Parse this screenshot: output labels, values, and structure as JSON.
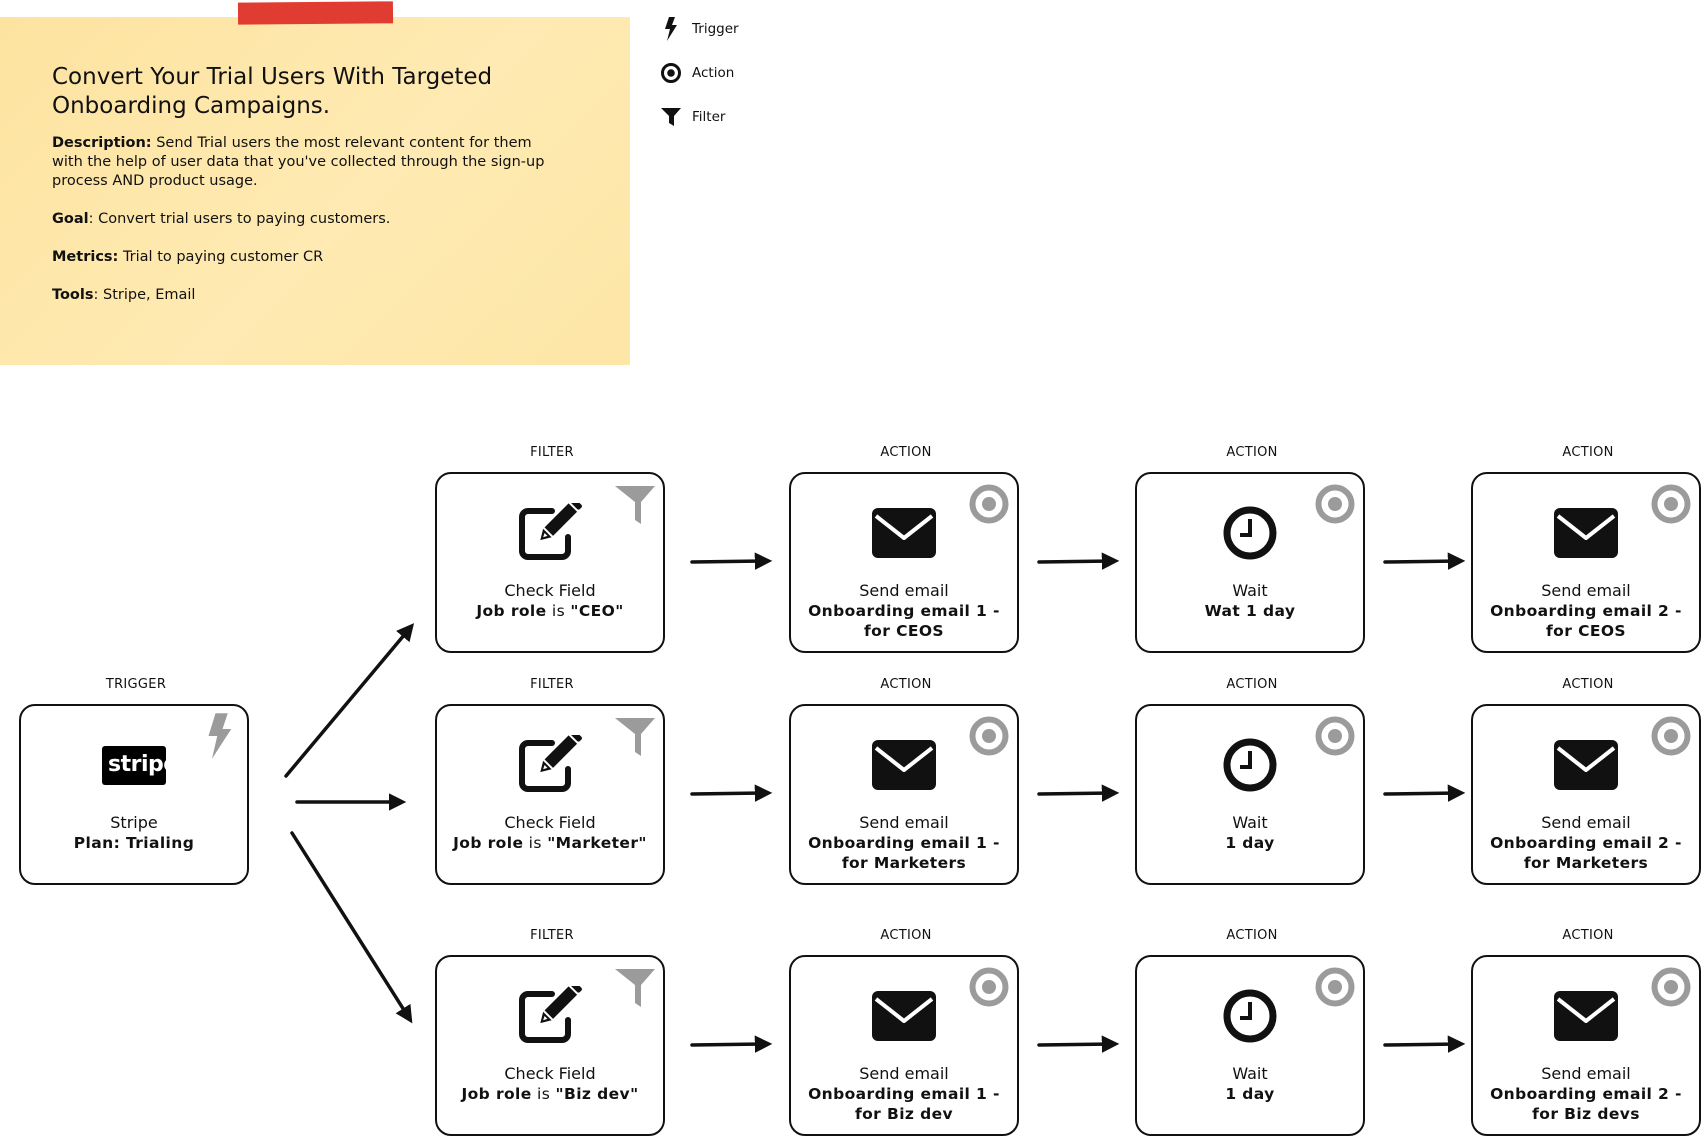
{
  "note": {
    "title": "Convert Your Trial Users With Targeted Onboarding Campaigns.",
    "description_label": "Description:",
    "description_text": " Send Trial users the most relevant content for them with the help of user data that you've collected through the sign-up process AND product usage.",
    "goal_label": "Goal",
    "goal_text": ": Convert trial users to paying customers.",
    "metrics_label": "Metrics:",
    "metrics_text": " Trial to paying customer CR",
    "tools_label": "Tools",
    "tools_text": ": Stripe, Email",
    "tape_color": "#e03c31",
    "paper_color": "#fde7a8"
  },
  "legend": [
    {
      "icon": "lightning-icon",
      "label": "Trigger"
    },
    {
      "icon": "target-icon",
      "label": "Action"
    },
    {
      "icon": "funnel-icon",
      "label": "Filter"
    }
  ],
  "trigger": {
    "stage": "TRIGGER",
    "logo_text": "stripe",
    "title": "Stripe",
    "detail": "Plan: Trialing",
    "corner_icon": "lightning-icon"
  },
  "rows": [
    {
      "filter": {
        "stage": "FILTER",
        "title": "Check Field",
        "detail_pre": "Job role",
        "detail_mid": " is ",
        "detail_post": "\"CEO\"",
        "corner_icon": "funnel-icon",
        "icon": "edit-icon"
      },
      "action1": {
        "stage": "ACTION",
        "title": "Send email",
        "detail": "Onboarding email 1 - for CEOS",
        "corner_icon": "target-icon",
        "icon": "envelope-icon"
      },
      "wait": {
        "stage": "ACTION",
        "title": "Wait",
        "detail": "Wat 1 day",
        "corner_icon": "target-icon",
        "icon": "clock-icon"
      },
      "action2": {
        "stage": "ACTION",
        "title": "Send email",
        "detail": "Onboarding email 2 - for CEOS",
        "corner_icon": "target-icon",
        "icon": "envelope-icon"
      }
    },
    {
      "filter": {
        "stage": "FILTER",
        "title": "Check Field",
        "detail_pre": "Job role",
        "detail_mid": " is ",
        "detail_post": "\"Marketer\"",
        "corner_icon": "funnel-icon",
        "icon": "edit-icon"
      },
      "action1": {
        "stage": "ACTION",
        "title": "Send email",
        "detail": "Onboarding email 1 - for Marketers",
        "corner_icon": "target-icon",
        "icon": "envelope-icon"
      },
      "wait": {
        "stage": "ACTION",
        "title": "Wait",
        "detail": "1 day",
        "corner_icon": "target-icon",
        "icon": "clock-icon"
      },
      "action2": {
        "stage": "ACTION",
        "title": "Send email",
        "detail": "Onboarding email 2 - for Marketers",
        "corner_icon": "target-icon",
        "icon": "envelope-icon"
      }
    },
    {
      "filter": {
        "stage": "FILTER",
        "title": "Check Field",
        "detail_pre": "Job role",
        "detail_mid": " is ",
        "detail_post": "\"Biz dev\"",
        "corner_icon": "funnel-icon",
        "icon": "edit-icon"
      },
      "action1": {
        "stage": "ACTION",
        "title": "Send email",
        "detail": "Onboarding email 1 - for Biz dev",
        "corner_icon": "target-icon",
        "icon": "envelope-icon"
      },
      "wait": {
        "stage": "ACTION",
        "title": "Wait",
        "detail": "1 day",
        "corner_icon": "target-icon",
        "icon": "clock-icon"
      },
      "action2": {
        "stage": "ACTION",
        "title": "Send email",
        "detail": "Onboarding email 2 - for Biz devs",
        "corner_icon": "target-icon",
        "icon": "envelope-icon"
      }
    }
  ],
  "colors": {
    "icon_gray": "#9b9b9b",
    "ink": "#111111"
  }
}
